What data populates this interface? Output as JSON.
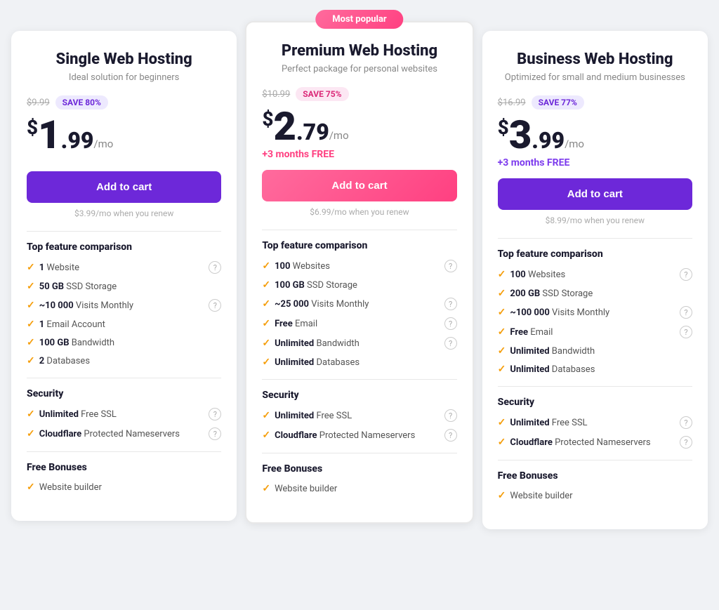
{
  "plans": [
    {
      "id": "single",
      "title": "Single Web Hosting",
      "subtitle": "Ideal solution for beginners",
      "popular": false,
      "originalPrice": "$9.99",
      "saveLabel": "SAVE 80%",
      "saveBadgeStyle": "purple",
      "priceWhole": "1",
      "priceDecimal": ".99",
      "pricePer": "/mo",
      "freeMonths": "",
      "btnLabel": "Add to cart",
      "btnStyle": "btn-purple",
      "renewText": "$3.99/mo when you renew",
      "featuresSectionTitle": "Top feature comparison",
      "features": [
        {
          "bold": "1",
          "text": " Website",
          "hasInfo": true
        },
        {
          "bold": "50 GB",
          "text": " SSD Storage",
          "hasInfo": false
        },
        {
          "bold": "~10 000",
          "text": " Visits Monthly",
          "hasInfo": true
        },
        {
          "bold": "1",
          "text": " Email Account",
          "hasInfo": false
        },
        {
          "bold": "100 GB",
          "text": " Bandwidth",
          "hasInfo": false
        },
        {
          "bold": "2",
          "text": " Databases",
          "hasInfo": false
        }
      ],
      "securityTitle": "Security",
      "security": [
        {
          "bold": "Unlimited",
          "text": " Free SSL",
          "hasInfo": true
        },
        {
          "bold": "Cloudflare",
          "text": " Protected Nameservers",
          "hasInfo": true
        }
      ],
      "bonusTitle": "Free Bonuses",
      "bonuses": [
        {
          "bold": "",
          "text": "Website builder",
          "hasInfo": false
        }
      ]
    },
    {
      "id": "premium",
      "title": "Premium Web Hosting",
      "subtitle": "Perfect package for personal websites",
      "popular": true,
      "popularLabel": "Most popular",
      "originalPrice": "$10.99",
      "saveLabel": "SAVE 75%",
      "saveBadgeStyle": "pink",
      "priceWhole": "2",
      "priceDecimal": ".79",
      "pricePer": "/mo",
      "freeMonths": "+3 months FREE",
      "freeMonthsStyle": "pink",
      "btnLabel": "Add to cart",
      "btnStyle": "btn-pink",
      "renewText": "$6.99/mo when you renew",
      "featuresSectionTitle": "Top feature comparison",
      "features": [
        {
          "bold": "100",
          "text": " Websites",
          "hasInfo": true
        },
        {
          "bold": "100 GB",
          "text": " SSD Storage",
          "hasInfo": false
        },
        {
          "bold": "~25 000",
          "text": " Visits Monthly",
          "hasInfo": true
        },
        {
          "bold": "Free",
          "text": " Email",
          "hasInfo": true
        },
        {
          "bold": "Unlimited",
          "text": " Bandwidth",
          "hasInfo": true
        },
        {
          "bold": "Unlimited",
          "text": " Databases",
          "hasInfo": false
        }
      ],
      "securityTitle": "Security",
      "security": [
        {
          "bold": "Unlimited",
          "text": " Free SSL",
          "hasInfo": true
        },
        {
          "bold": "Cloudflare",
          "text": " Protected Nameservers",
          "hasInfo": true
        }
      ],
      "bonusTitle": "Free Bonuses",
      "bonuses": [
        {
          "bold": "",
          "text": "Website builder",
          "hasInfo": false
        }
      ]
    },
    {
      "id": "business",
      "title": "Business Web Hosting",
      "subtitle": "Optimized for small and medium businesses",
      "popular": false,
      "originalPrice": "$16.99",
      "saveLabel": "SAVE 77%",
      "saveBadgeStyle": "purple",
      "priceWhole": "3",
      "priceDecimal": ".99",
      "pricePer": "/mo",
      "freeMonths": "+3 months FREE",
      "freeMonthsStyle": "purple",
      "btnLabel": "Add to cart",
      "btnStyle": "btn-purple",
      "renewText": "$8.99/mo when you renew",
      "featuresSectionTitle": "Top feature comparison",
      "features": [
        {
          "bold": "100",
          "text": " Websites",
          "hasInfo": true
        },
        {
          "bold": "200 GB",
          "text": " SSD Storage",
          "hasInfo": false
        },
        {
          "bold": "~100 000",
          "text": " Visits Monthly",
          "hasInfo": true
        },
        {
          "bold": "Free",
          "text": " Email",
          "hasInfo": true
        },
        {
          "bold": "Unlimited",
          "text": " Bandwidth",
          "hasInfo": false
        },
        {
          "bold": "Unlimited",
          "text": " Databases",
          "hasInfo": false
        }
      ],
      "securityTitle": "Security",
      "security": [
        {
          "bold": "Unlimited",
          "text": " Free SSL",
          "hasInfo": true
        },
        {
          "bold": "Cloudflare",
          "text": " Protected Nameservers",
          "hasInfo": true
        }
      ],
      "bonusTitle": "Free Bonuses",
      "bonuses": [
        {
          "bold": "",
          "text": "Website builder",
          "hasInfo": false
        }
      ]
    }
  ]
}
